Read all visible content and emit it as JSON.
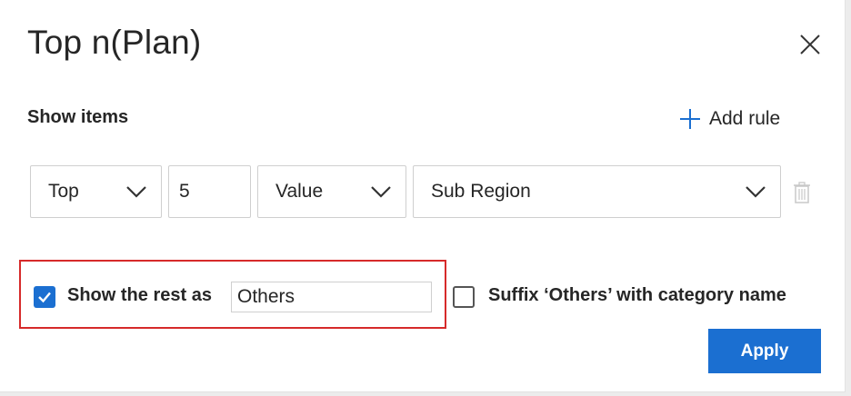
{
  "dialog": {
    "title": "Top n(Plan)",
    "close_icon": "close-icon"
  },
  "show_items": {
    "label": "Show items",
    "add_rule_label": "Add rule",
    "add_rule_icon": "plus-icon"
  },
  "rule": {
    "direction": "Top",
    "count": "5",
    "by": "Value",
    "category": "Sub Region",
    "delete_icon": "trash-icon"
  },
  "options": {
    "show_rest_label": "Show the rest as",
    "show_rest_checked": true,
    "others_value": "Others",
    "suffix_label": "Suffix ‘Others’ with category name",
    "suffix_checked": false
  },
  "footer": {
    "apply_label": "Apply"
  },
  "colors": {
    "accent": "#1b6fd1",
    "highlight_border": "#d62a2a",
    "text": "#262626"
  }
}
